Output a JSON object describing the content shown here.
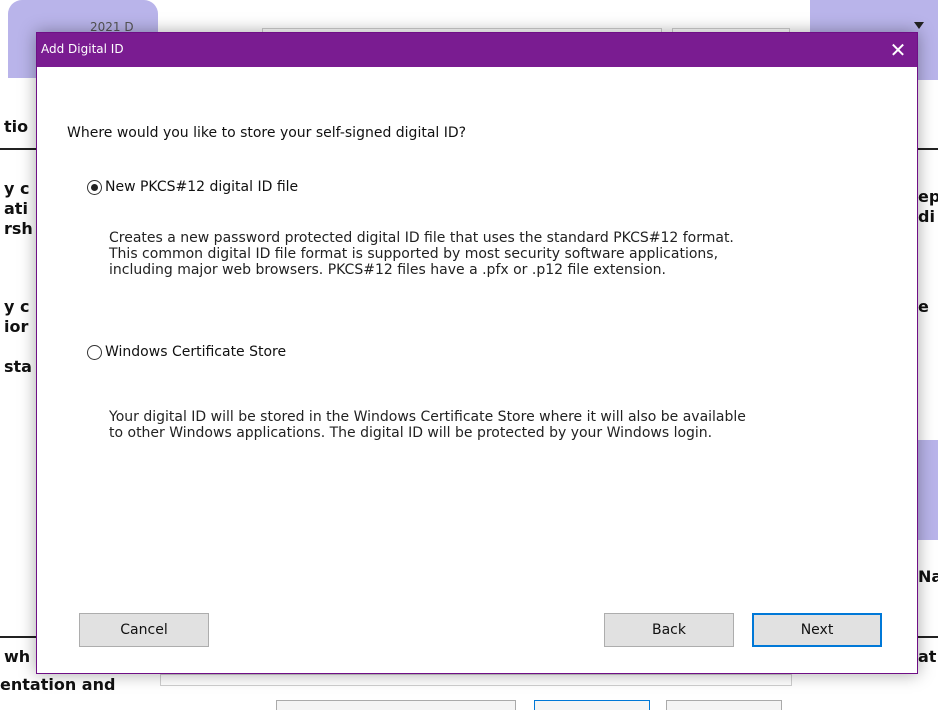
{
  "background": {
    "tab_label": "2021 D",
    "fragments_left": [
      "tio",
      "y c",
      "ati",
      "rsh",
      "y c",
      "ior",
      "sta",
      "wh",
      "entation and"
    ],
    "fragments_right": [
      "ep",
      "di",
      "e",
      "Na",
      "at"
    ]
  },
  "dialog": {
    "title": "Add Digital ID",
    "close_glyph": "✕",
    "question": "Where would you like to store your self-signed digital ID?",
    "options": [
      {
        "label": "New PKCS#12 digital ID file",
        "selected": true,
        "description": [
          "Creates a new password protected digital ID file that uses the standard PKCS#12 format.",
          "This common digital ID file format is supported by most security software applications,",
          "including major web browsers. PKCS#12 files have a .pfx or .p12 file extension."
        ]
      },
      {
        "label": "Windows Certificate Store",
        "selected": false,
        "description": [
          "Your digital ID will be stored in the Windows Certificate Store where it will also be available",
          "to other Windows applications. The digital ID will be protected by your Windows login."
        ]
      }
    ],
    "buttons": {
      "cancel": "Cancel",
      "back": "Back",
      "next": "Next"
    }
  },
  "colors": {
    "titlebar": "#7a1c91",
    "background_accent": "#b9b4ea",
    "default_button_border": "#0078d7"
  }
}
